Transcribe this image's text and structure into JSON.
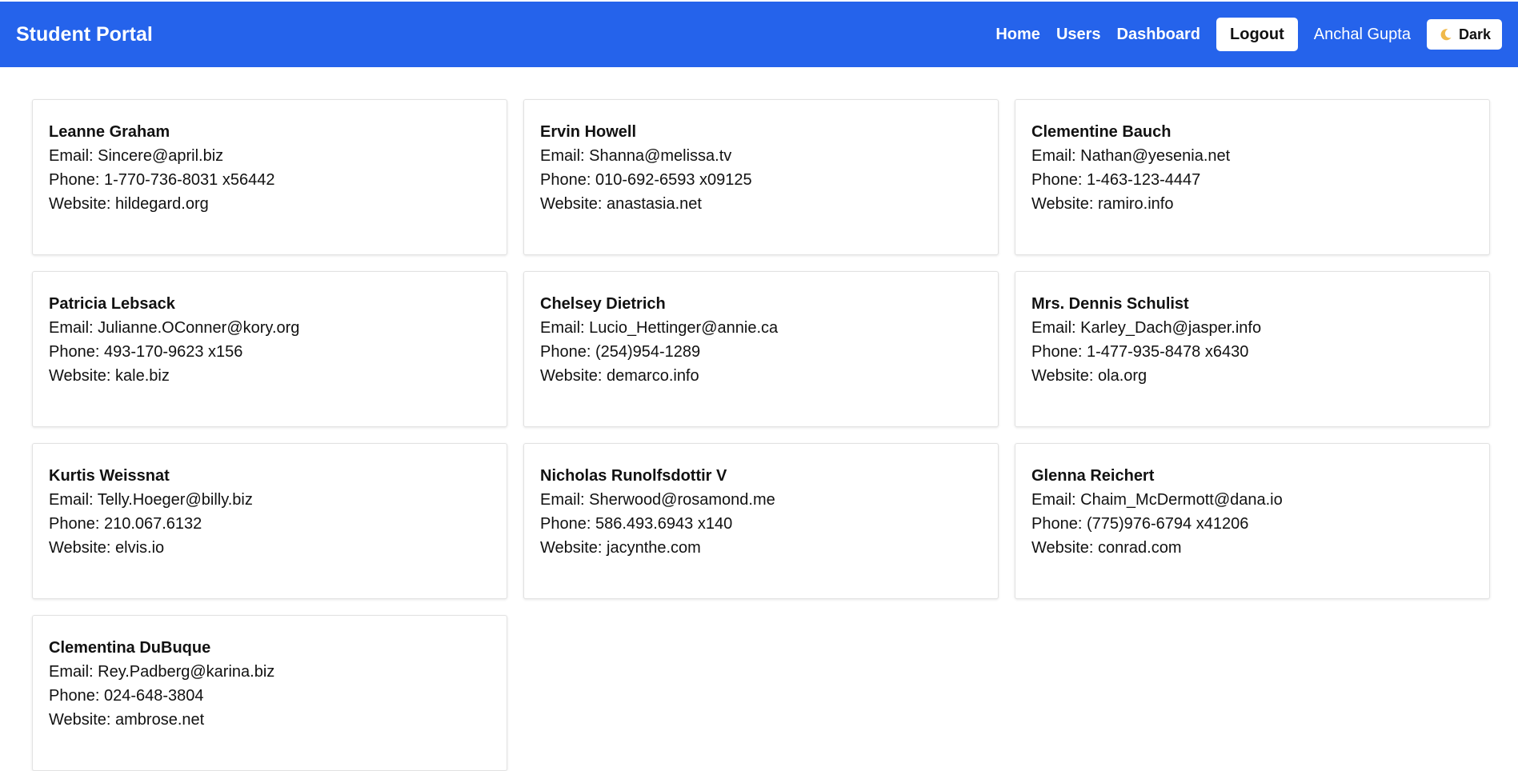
{
  "navbar": {
    "brand": "Student Portal",
    "links": [
      "Home",
      "Users",
      "Dashboard"
    ],
    "logout_label": "Logout",
    "user_name": "Anchal Gupta",
    "theme_label": "Dark",
    "theme_icon": "moon-icon",
    "background_color": "#2563eb"
  },
  "labels": {
    "email": "Email: ",
    "phone": "Phone: ",
    "website": "Website: "
  },
  "users": [
    {
      "name": "Leanne Graham",
      "email": "Sincere@april.biz",
      "phone": "1-770-736-8031 x56442",
      "website": "hildegard.org"
    },
    {
      "name": "Ervin Howell",
      "email": "Shanna@melissa.tv",
      "phone": "010-692-6593 x09125",
      "website": "anastasia.net"
    },
    {
      "name": "Clementine Bauch",
      "email": "Nathan@yesenia.net",
      "phone": "1-463-123-4447",
      "website": "ramiro.info"
    },
    {
      "name": "Patricia Lebsack",
      "email": "Julianne.OConner@kory.org",
      "phone": "493-170-9623 x156",
      "website": "kale.biz"
    },
    {
      "name": "Chelsey Dietrich",
      "email": "Lucio_Hettinger@annie.ca",
      "phone": "(254)954-1289",
      "website": "demarco.info"
    },
    {
      "name": "Mrs. Dennis Schulist",
      "email": "Karley_Dach@jasper.info",
      "phone": "1-477-935-8478 x6430",
      "website": "ola.org"
    },
    {
      "name": "Kurtis Weissnat",
      "email": "Telly.Hoeger@billy.biz",
      "phone": "210.067.6132",
      "website": "elvis.io"
    },
    {
      "name": "Nicholas Runolfsdottir V",
      "email": "Sherwood@rosamond.me",
      "phone": "586.493.6943 x140",
      "website": "jacynthe.com"
    },
    {
      "name": "Glenna Reichert",
      "email": "Chaim_McDermott@dana.io",
      "phone": "(775)976-6794 x41206",
      "website": "conrad.com"
    },
    {
      "name": "Clementina DuBuque",
      "email": "Rey.Padberg@karina.biz",
      "phone": "024-648-3804",
      "website": "ambrose.net"
    }
  ]
}
